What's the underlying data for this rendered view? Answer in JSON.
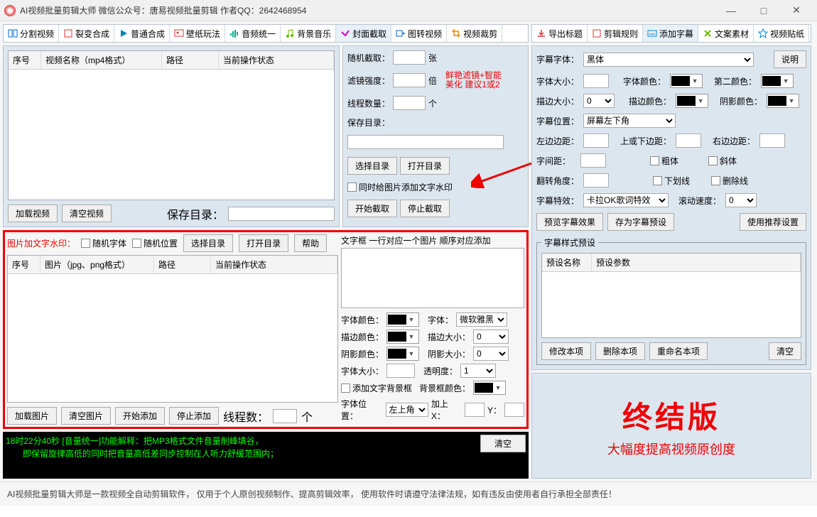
{
  "titlebar": {
    "title": "AI视频批量剪辑大师   微信公众号：唐易视频批量剪辑   作者QQ：2642468954"
  },
  "left_tabs": [
    "分割视频",
    "裂变合成",
    "普通合成",
    "壁纸玩法",
    "音频统一",
    "背景音乐",
    "封面截取",
    "图转视频",
    "视频裁剪"
  ],
  "right_tabs": [
    "导出标题",
    "剪辑规则",
    "添加字幕",
    "文案素材",
    "视频贴纸"
  ],
  "video_grid": {
    "cols": [
      "序号",
      "视频名称（mp4格式）",
      "路径",
      "当前操作状态"
    ]
  },
  "video_buttons": {
    "load": "加载视频",
    "clear": "清空视频",
    "savedir_label": "保存目录："
  },
  "cover": {
    "rand_count": "随机截取：",
    "unit_zhang": "张",
    "filter_strength": "滤镜强度：",
    "unit_bei": "倍",
    "red_hint1": "鲜艳滤镜+智能",
    "red_hint2": "美化 建议1或2",
    "threads": "线程数量：",
    "unit_ge": "个",
    "savedir": "保存目录：",
    "choosedir": "选择目录",
    "opendir": "打开目录",
    "watermark_chk": "同时给图片添加文字水印",
    "start": "开始截取",
    "stop": "停止截取"
  },
  "img_wm": {
    "title": "图片加文字水印：",
    "rand_font": "随机字体",
    "rand_pos": "随机位置",
    "choosedir": "选择目录",
    "opendir": "打开目录",
    "help": "帮助",
    "cols": [
      "序号",
      "图片（jpg、png格式）",
      "路径",
      "当前操作状态"
    ],
    "load": "加载图片",
    "clear": "清空图片",
    "start": "开始添加",
    "stop": "停止添加",
    "threads": "线程数：",
    "threads_unit": "个"
  },
  "textbox": {
    "hint": "文字框 一行对应一个图片 顺序对应添加",
    "font_color": "字体颜色：",
    "font": "字体：",
    "font_val": "微软雅黑",
    "stroke_color": "描边颜色：",
    "stroke_size": "描边大小：",
    "stroke_val": "0",
    "shadow_color": "阴影颜色：",
    "shadow_size": "阴影大小：",
    "shadow_val": "0",
    "font_size": "字体大小：",
    "opacity": "透明度：",
    "opacity_val": "1",
    "bg_chk": "添加文字背景框",
    "bg_color": "背景框颜色：",
    "pos": "字体位置：",
    "pos_val": "左上角",
    "addx": "加上X：",
    "y": "Y："
  },
  "log": {
    "line1": "18时22分40秒 [音量统一]功能解释：把MP3格式文件音量削峰填谷，",
    "line2": "　　即保留旋律高低的同时把音量高低差同步控制在人听力舒缓范围内；",
    "clear": "清空"
  },
  "subtitle": {
    "explain": "说明",
    "font_label": "字幕字体：",
    "font_val": "黑体",
    "size_label": "字体大小：",
    "color_label": "字体颜色：",
    "color2_label": "第二颜色：",
    "stroke_size": "描边大小：",
    "stroke_val": "0",
    "stroke_color": "描边颜色：",
    "shadow_color": "阴影颜色：",
    "pos_label": "字幕位置：",
    "pos_val": "屏幕左下角",
    "left_margin": "左边边距：",
    "tb_margin": "上或下边距：",
    "right_margin": "右边边距：",
    "spacing": "字间距：",
    "bold": "粗体",
    "italic": "斜体",
    "rotate": "翻转角度：",
    "underline": "下划线",
    "strike": "删除线",
    "effect_label": "字幕特效：",
    "effect_val": "卡拉OK歌词特效",
    "speed_label": "滚动速度：",
    "speed_val": "0",
    "preview": "预览字幕效果",
    "save_preset": "存为字幕预设",
    "recommend": "使用推荐设置",
    "preset_legend": "字幕样式预设",
    "preset_cols": [
      "预设名称",
      "预设参数"
    ],
    "mod": "修改本项",
    "del": "删除本项",
    "rename": "重命名本项",
    "clear": "清空"
  },
  "bigred": {
    "big": "终结版",
    "sub": "大幅度提高视频原创度"
  },
  "footer": "AI视频批量剪辑大师是一款视频全自动剪辑软件，  仅用于个人原创视频制作、提高剪辑效率，  使用软件时请遵守法律法规，如有违反由使用者自行承担全部责任！"
}
